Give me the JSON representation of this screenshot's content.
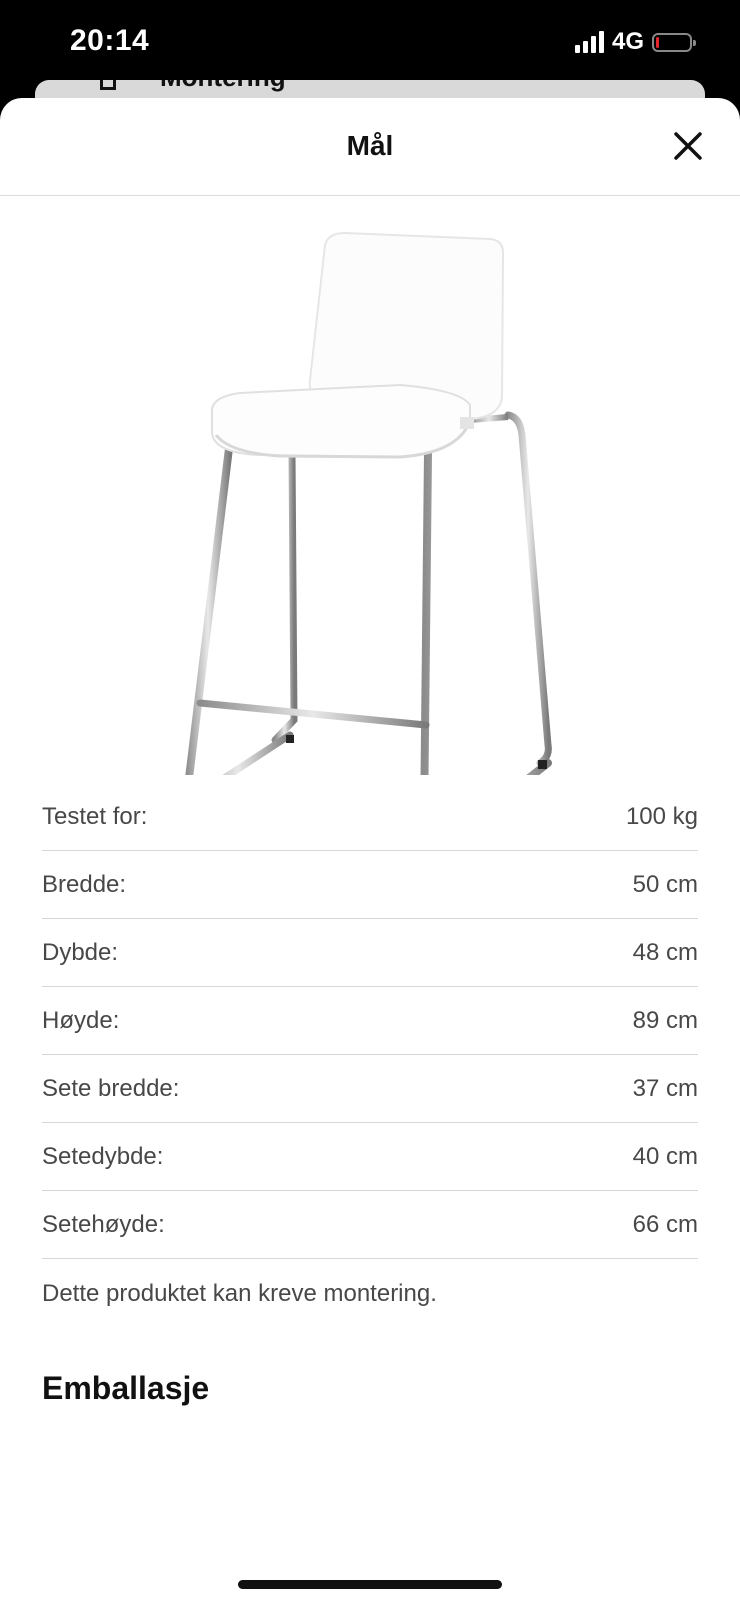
{
  "status_bar": {
    "time": "20:14",
    "network": "4G",
    "battery_level_percent": 5
  },
  "behind_card": {
    "label": "Montering"
  },
  "sheet": {
    "title": "Mål",
    "close_icon": "close-icon"
  },
  "product_image": {
    "description_icon": "bar-stool-image"
  },
  "dimensions": [
    {
      "label": "Testet for:",
      "value": "100 kg"
    },
    {
      "label": "Bredde:",
      "value": "50 cm"
    },
    {
      "label": "Dybde:",
      "value": "48 cm"
    },
    {
      "label": "Høyde:",
      "value": "89 cm"
    },
    {
      "label": "Sete bredde:",
      "value": "37 cm"
    },
    {
      "label": "Setedybde:",
      "value": "40 cm"
    },
    {
      "label": "Setehøyde:",
      "value": "66 cm"
    }
  ],
  "note": "Dette produktet kan kreve montering.",
  "packaging": {
    "heading": "Emballasje"
  }
}
